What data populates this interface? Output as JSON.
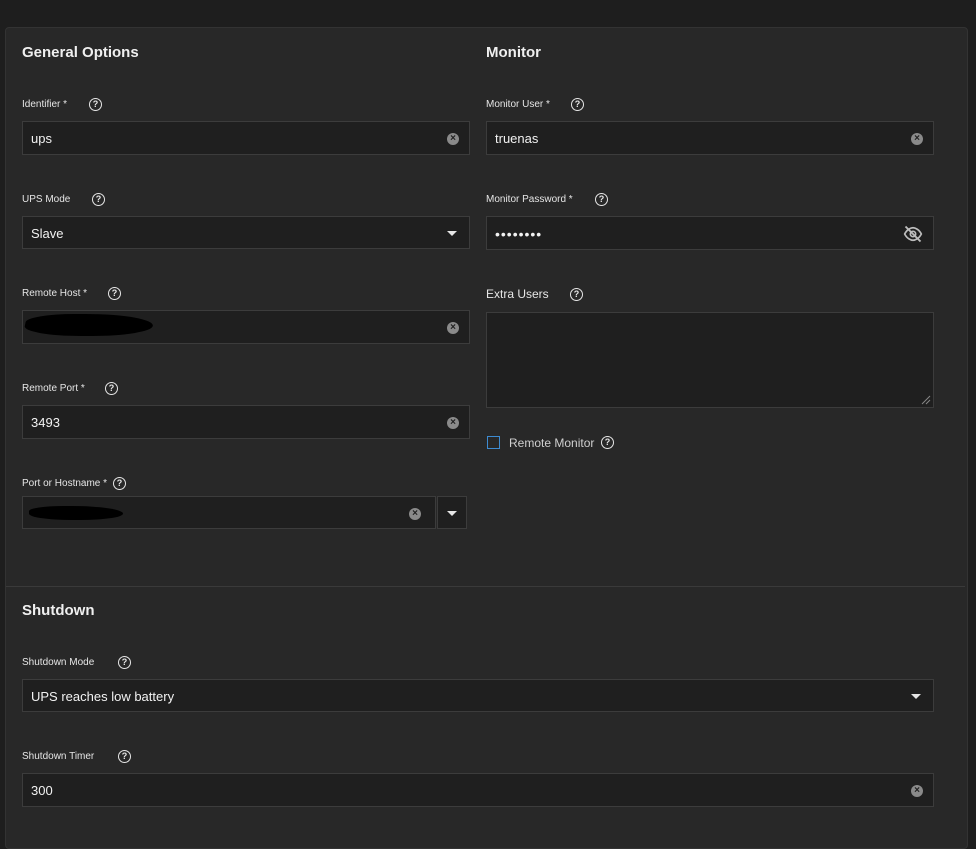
{
  "general": {
    "title": "General Options",
    "identifier": {
      "label": "Identifier *",
      "value": "ups"
    },
    "ups_mode": {
      "label": "UPS Mode",
      "value": "Slave"
    },
    "remote_host": {
      "label": "Remote Host *",
      "value": ""
    },
    "remote_port": {
      "label": "Remote Port *",
      "value": "3493"
    },
    "port_or_hostname": {
      "label": "Port or Hostname *",
      "value": ""
    }
  },
  "monitor": {
    "title": "Monitor",
    "monitor_user": {
      "label": "Monitor User *",
      "value": "truenas"
    },
    "monitor_password": {
      "label": "Monitor Password *",
      "value": "••••••••"
    },
    "extra_users": {
      "label": "Extra Users",
      "value": ""
    },
    "remote_monitor": {
      "label": "Remote Monitor",
      "checked": false
    }
  },
  "shutdown": {
    "title": "Shutdown",
    "shutdown_mode": {
      "label": "Shutdown Mode",
      "value": "UPS reaches low battery"
    },
    "shutdown_timer": {
      "label": "Shutdown Timer",
      "value": "300"
    }
  },
  "icons": {
    "help": "help-circle-icon",
    "clear": "clear-circle-icon",
    "dropdown": "chevron-down-icon",
    "visibility": "eye-off-icon"
  },
  "colors": {
    "background": "#1e1e1e",
    "card": "#282828",
    "field": "#1f1f1f",
    "accent": "#3d8bd1"
  }
}
